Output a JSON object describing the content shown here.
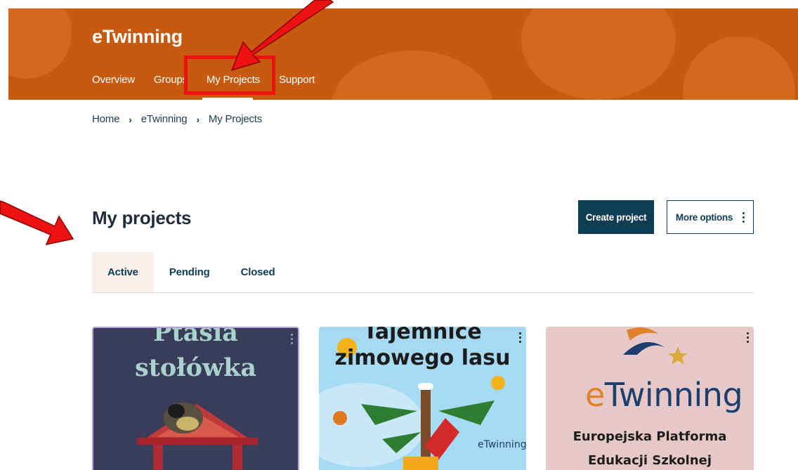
{
  "header": {
    "brand": "eTwinning",
    "nav": [
      {
        "label": "Overview"
      },
      {
        "label": "Groups"
      },
      {
        "label": "My Projects"
      },
      {
        "label": "Support"
      }
    ]
  },
  "breadcrumb": [
    "Home",
    "eTwinning",
    "My Projects"
  ],
  "main": {
    "title": "My projects",
    "create_label": "Create project",
    "more_label": "More options",
    "tabs": [
      {
        "label": "Active"
      },
      {
        "label": "Pending"
      },
      {
        "label": "Closed"
      }
    ]
  },
  "cards": [
    {
      "line1": "Ptasia",
      "line2": "stołówka"
    },
    {
      "line1": "Tajemnice",
      "line2": "zimowego lasu",
      "badge": "eTwinning"
    },
    {
      "logo": "eTwinning",
      "line1": "Europejska Platforma",
      "line2": "Edukacji Szkolnej"
    }
  ],
  "colors": {
    "header_bg": "#c85a0f",
    "primary_button": "#0e3d54",
    "annotation_red": "#ee1111"
  }
}
